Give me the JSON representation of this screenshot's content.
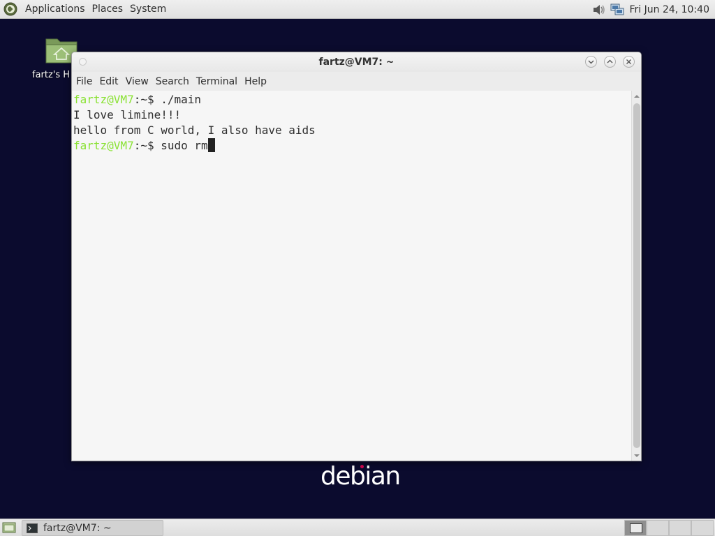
{
  "top_panel": {
    "menus": [
      "Applications",
      "Places",
      "System"
    ],
    "clock": "Fri Jun 24, 10:40",
    "icons": [
      "debian-menu-icon",
      "volume-icon",
      "network-icon"
    ]
  },
  "desktop": {
    "home_icon_label": "fartz's H",
    "logo_text": "debian"
  },
  "window": {
    "title": "fartz@VM7: ~",
    "menus": [
      "File",
      "Edit",
      "View",
      "Search",
      "Terminal",
      "Help"
    ],
    "terminal": {
      "lines": [
        {
          "user": "fartz@VM7",
          "sep": ":~$",
          "cmd": " ./main"
        },
        {
          "text": "I love limine!!!"
        },
        {
          "text": "hello from C world, I also have aids"
        },
        {
          "user": "fartz@VM7",
          "sep": ":~$",
          "cmd": " sudo rm"
        }
      ]
    }
  },
  "taskbar": {
    "task_label": "fartz@VM7: ~",
    "workspace_count": 4,
    "active_workspace": 1
  },
  "colors": {
    "desktop_bg": "#0b0b2e",
    "prompt_user": "#8ae234",
    "debian_red": "#d70751"
  }
}
